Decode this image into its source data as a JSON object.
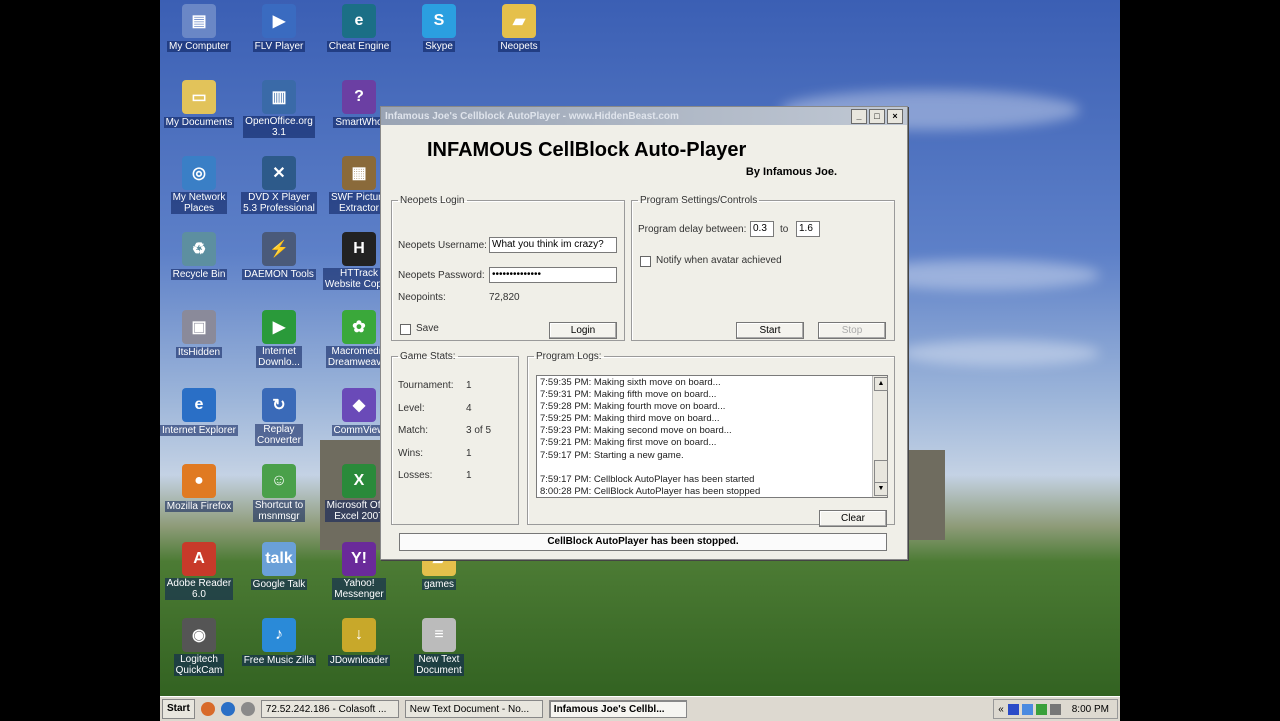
{
  "desktop_icons": [
    {
      "label": "My Computer",
      "glyph": "▤",
      "color": "#6a87c6"
    },
    {
      "label": "FLV Player",
      "glyph": "▶",
      "color": "#3a6bc0"
    },
    {
      "label": "Cheat Engine",
      "glyph": "e",
      "color": "#1b6f86"
    },
    {
      "label": "Skype",
      "glyph": "S",
      "color": "#2b9fe0"
    },
    {
      "label": "Neopets",
      "glyph": "▰",
      "color": "#e5c04b"
    },
    {
      "label": "My Documents",
      "glyph": "▭",
      "color": "#e2c35a"
    },
    {
      "label": "OpenOffice.org\n3.1",
      "glyph": "▥",
      "color": "#3a6aa8"
    },
    {
      "label": "SmartWho",
      "glyph": "?",
      "color": "#6b3fa3"
    },
    {
      "label": "My Network\nPlaces",
      "glyph": "◎",
      "color": "#3a7fc6"
    },
    {
      "label": "DVD X Player\n5.3 Professional",
      "glyph": "✕",
      "color": "#2d5a8a"
    },
    {
      "label": "SWF Picture\nExtractor",
      "glyph": "▦",
      "color": "#8a6a3a"
    },
    {
      "label": "Recycle Bin",
      "glyph": "♻",
      "color": "#5d8fa0"
    },
    {
      "label": "DAEMON Tools",
      "glyph": "⚡",
      "color": "#4a5a7a"
    },
    {
      "label": "HTTrack\nWebsite Copier",
      "glyph": "H",
      "color": "#222"
    },
    {
      "label": "ItsHidden",
      "glyph": "▣",
      "color": "#8a8a9a"
    },
    {
      "label": "Internet\nDownlo...",
      "glyph": "▶",
      "color": "#2a9a3a"
    },
    {
      "label": "Macromedia\nDreamweaver",
      "glyph": "✿",
      "color": "#3aa83a"
    },
    {
      "label": "Internet Explorer",
      "glyph": "e",
      "color": "#2a6fc6"
    },
    {
      "label": "Replay\nConverter",
      "glyph": "↻",
      "color": "#3a6ab8"
    },
    {
      "label": "CommView",
      "glyph": "◆",
      "color": "#6a4ab8"
    },
    {
      "label": "Mozilla Firefox",
      "glyph": "●",
      "color": "#e07a22"
    },
    {
      "label": "Shortcut to\nmsnmsgr",
      "glyph": "☺",
      "color": "#4aa04a"
    },
    {
      "label": "Microsoft Off...\nExcel 2007",
      "glyph": "X",
      "color": "#2a8a3a"
    },
    {
      "label": "Adobe Reader\n6.0",
      "glyph": "A",
      "color": "#c83a2a"
    },
    {
      "label": "Google Talk",
      "glyph": "talk",
      "color": "#6aa0d8"
    },
    {
      "label": "Yahoo!\nMessenger",
      "glyph": "Y!",
      "color": "#6a2a9a"
    },
    {
      "label": "games",
      "glyph": "▰",
      "color": "#e5c04b"
    },
    {
      "label": "Logitech\nQuickCam",
      "glyph": "◉",
      "color": "#555"
    },
    {
      "label": "Free Music Zilla",
      "glyph": "♪",
      "color": "#2a8ad8"
    },
    {
      "label": "JDownloader",
      "glyph": "↓",
      "color": "#c8a82a"
    },
    {
      "label": "New Text\nDocument",
      "glyph": "≡",
      "color": "#bbb"
    }
  ],
  "window": {
    "title": "Infamous Joe's Cellblock AutoPlayer - www.HiddenBeast.com",
    "minimize": "_",
    "maximize": "□",
    "close": "×",
    "app_title": "INFAMOUS CellBlock Auto-Player",
    "byline": "By Infamous Joe.",
    "login": {
      "legend": "Neopets Login",
      "username_label": "Neopets Username:",
      "username_value": "What you think im crazy?",
      "password_label": "Neopets Password:",
      "password_value": "••••••••••••••",
      "neopoints_label": "Neopoints:",
      "neopoints_value": "72,820",
      "save_label": "Save",
      "save_checked": false,
      "login_button": "Login"
    },
    "settings": {
      "legend": "Program Settings/Controls",
      "delay_label": "Program delay between:",
      "delay_min": "0.3",
      "to_label": "to",
      "delay_max": "1.6",
      "notify_label": "Notify when avatar achieved",
      "notify_checked": false,
      "start_button": "Start",
      "stop_button": "Stop"
    },
    "stats": {
      "legend": "Game Stats:",
      "rows": [
        {
          "label": "Tournament:",
          "value": "1"
        },
        {
          "label": "Level:",
          "value": "4"
        },
        {
          "label": "Match:",
          "value": "3 of 5"
        },
        {
          "label": "Wins:",
          "value": "1"
        },
        {
          "label": "Losses:",
          "value": "1"
        }
      ]
    },
    "logs": {
      "legend": "Program Logs:",
      "lines": [
        "7:59:35 PM: Making sixth move on board...",
        "7:59:31 PM: Making fifth move on board...",
        "7:59:28 PM: Making fourth move on board...",
        "7:59:25 PM: Making third move on board...",
        "7:59:23 PM: Making second move on board...",
        "7:59:21 PM: Making first move on board...",
        "7:59:17 PM: Starting a new game.",
        "",
        "7:59:17 PM: Cellblock AutoPlayer has been started",
        "8:00:28 PM: CellBlock AutoPlayer has been stopped"
      ],
      "clear_button": "Clear"
    },
    "status": "CellBlock AutoPlayer has been stopped."
  },
  "taskbar": {
    "start_label": "Start",
    "tasks": [
      {
        "label": "72.52.242.186 - Colasoft ...",
        "active": false
      },
      {
        "label": "New Text Document - No...",
        "active": false
      },
      {
        "label": "Infamous Joe's Cellbl...",
        "active": true
      }
    ],
    "tray_expand": "«",
    "clock": "8:00 PM"
  }
}
